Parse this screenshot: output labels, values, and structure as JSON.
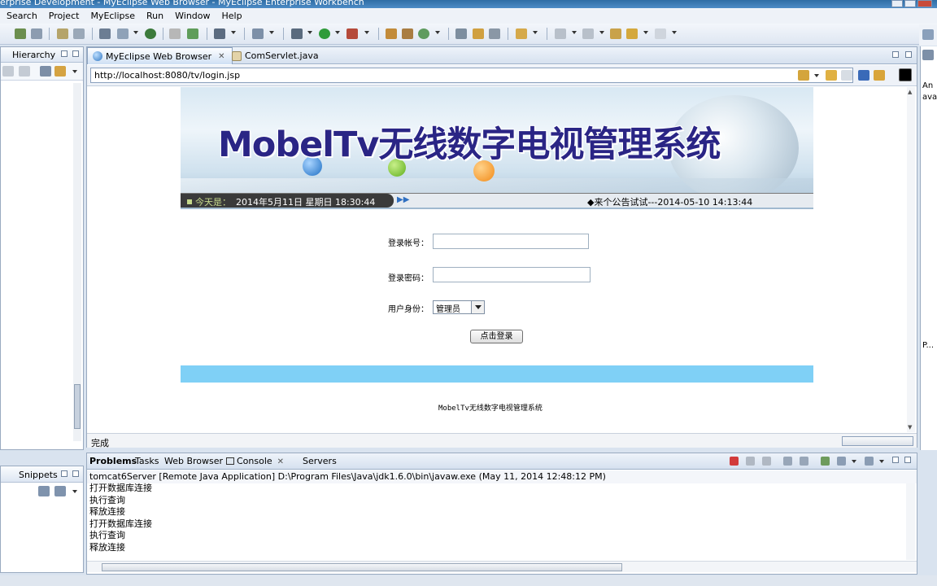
{
  "window": {
    "title": "erprise Development - MyEclipse Web Browser - MyEclipse Enterprise Workbench"
  },
  "menu": [
    "Search",
    "Project",
    "MyEclipse",
    "Run",
    "Window",
    "Help"
  ],
  "left_panel": {
    "tab": "Hierarchy"
  },
  "left_bottom": {
    "tab": "Snippets"
  },
  "editor_tabs": [
    {
      "label": "MyEclipse Web Browser",
      "active": true
    },
    {
      "label": "ComServlet.java",
      "active": false
    }
  ],
  "address": {
    "url": "http://localhost:8080/tv/login.jsp"
  },
  "page": {
    "banner_title": "MobelTv无线数字电视管理系统",
    "date_label": "今天是：",
    "date_value": "2014年5月11日 星期日 18:30:44",
    "notice": "◆来个公告试试---2014-05-10 14:13:44",
    "account_label": "登录帐号：",
    "password_label": "登录密码：",
    "role_label": "用户身份：",
    "role_selected": "管理员",
    "login_button": "点击登录",
    "footer": "MobelTv无线数字电视管理系统"
  },
  "status": {
    "text": "完成"
  },
  "right_panel": {
    "text1": "An",
    "text2": "avai",
    "tab": "P..."
  },
  "console": {
    "tabs": [
      "Problems",
      "Tasks",
      "Web Browser",
      "Console",
      "Servers"
    ],
    "info": "tomcat6Server [Remote Java Application] D:\\Program Files\\Java\\jdk1.6.0\\bin\\javaw.exe (May 11, 2014 12:48:12 PM)",
    "lines": [
      "打开数据库连接",
      "执行查询",
      "释放连接",
      "打开数据库连接",
      "执行查询",
      "释放连接"
    ]
  },
  "colors": {
    "accent": "#2a2585",
    "footer_band": "#7fd0f6",
    "titlebar": "#3f7db7"
  }
}
